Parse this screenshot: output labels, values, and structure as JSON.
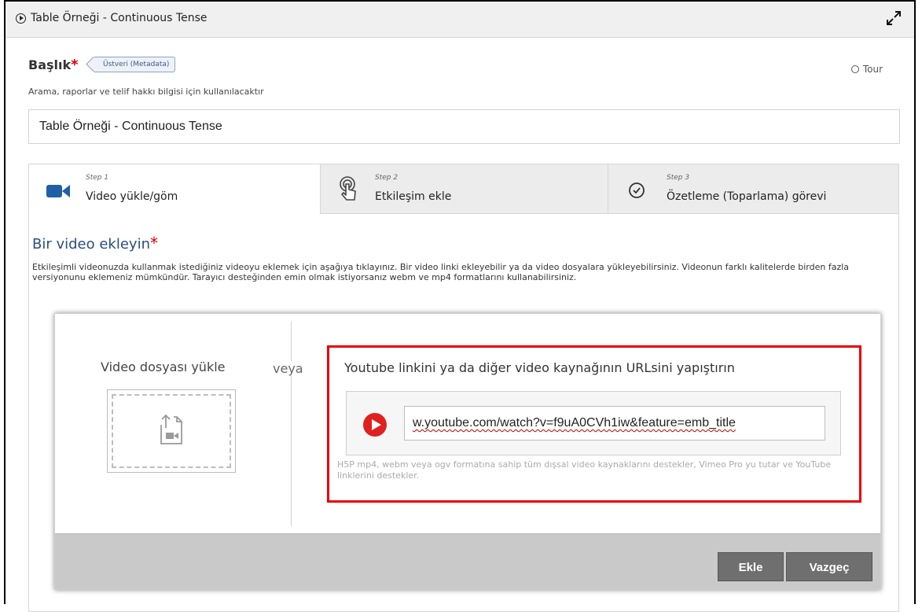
{
  "window": {
    "title": "Table Örneği - Continuous Tense"
  },
  "form": {
    "title_label": "Başlık",
    "required_mark": "*",
    "metadata_tag": "Üstveri (Metadata)",
    "tour_label": "Tour",
    "title_description": "Arama, raporlar ve telif hakkı bilgisi için kullanılacaktır",
    "title_value": "Table Örneği - Continuous Tense"
  },
  "tabs": [
    {
      "step": "Step 1",
      "label": "Video yükle/göm",
      "icon": "video-camera-icon",
      "active": true
    },
    {
      "step": "Step 2",
      "label": "Etkileşim ekle",
      "icon": "touch-icon",
      "active": false
    },
    {
      "step": "Step 3",
      "label": "Özetleme (Toparlama) görevi",
      "icon": "check-circle-icon",
      "active": false
    }
  ],
  "section": {
    "title": "Bir video ekleyin",
    "required_mark": "*",
    "description": "Etkileşimli videonuzda kullanmak istediğiniz videoyu eklemek için aşağıya tıklayınız. Bir video linki ekleyebilir ya da video dosyalara yükleyebilirsiniz. Videonun farklı kalitelerde birden fazla versiyonunu eklemeniz mümkündür. Tarayıcı desteğinden emin olmak istiyorsanız webm ve mp4 formatlarını kullanabilirsiniz."
  },
  "dialog": {
    "upload_title": "Video dosyası yükle",
    "or_label": "veya",
    "url_heading": "Youtube linkini ya da diğer video kaynağının URLsini yapıştırın",
    "url_value": "w.youtube.com/watch?v=f9uA0CVh1iw&feature=emb_title",
    "url_help": "H5P mp4, webm veya ogv formatına sahip tüm dışsal video kaynaklarını destekler, Vimeo Pro yu tutar ve YouTube linklerini destekler.",
    "add_button": "Ekle",
    "cancel_button": "Vazgeç"
  },
  "colors": {
    "accent_blue": "#2a4f7a",
    "required_red": "#d60000",
    "highlight_red": "#e8000b",
    "button_gray": "#6f6f6f",
    "youtube_red": "#e02020"
  }
}
